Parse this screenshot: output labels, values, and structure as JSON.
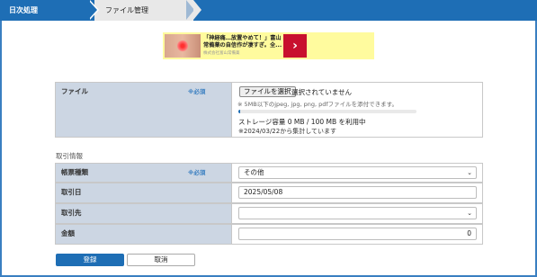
{
  "breadcrumb": {
    "items": [
      "日次処理",
      "ファイル管理"
    ]
  },
  "ad": {
    "title": "「神経痛…放置やめて！」富山常備薬の自信作が凄すぎ。全...",
    "sponsor": "株式会社富山常備薬",
    "arrow": "›"
  },
  "file_section": {
    "label": "ファイル",
    "required": "※必須",
    "choose_button": "ファイルを選択",
    "status": "選択されていません",
    "note": "※ 5MB以下のjpeg, jpg, png, pdfファイルを添付できます。",
    "storage_progress": 0.0,
    "storage": "ストレージ容量 0 MB / 100 MB を利用中",
    "aggregation_note": "※2024/03/22から集計しています"
  },
  "transaction": {
    "section_title": "取引情報",
    "doc_type": {
      "label": "帳票種類",
      "required": "※必須",
      "value": "その他"
    },
    "date": {
      "label": "取引日",
      "value": "2025/05/08"
    },
    "partner": {
      "label": "取引先",
      "value": ""
    },
    "amount": {
      "label": "金額",
      "value": "0"
    }
  },
  "actions": {
    "submit": "登録",
    "cancel": "取消"
  },
  "colors": {
    "primary": "#1e6eb5",
    "label_bg": "#ccd6e3",
    "ad_bg": "#fffb9e",
    "ad_button": "#c8102e"
  }
}
